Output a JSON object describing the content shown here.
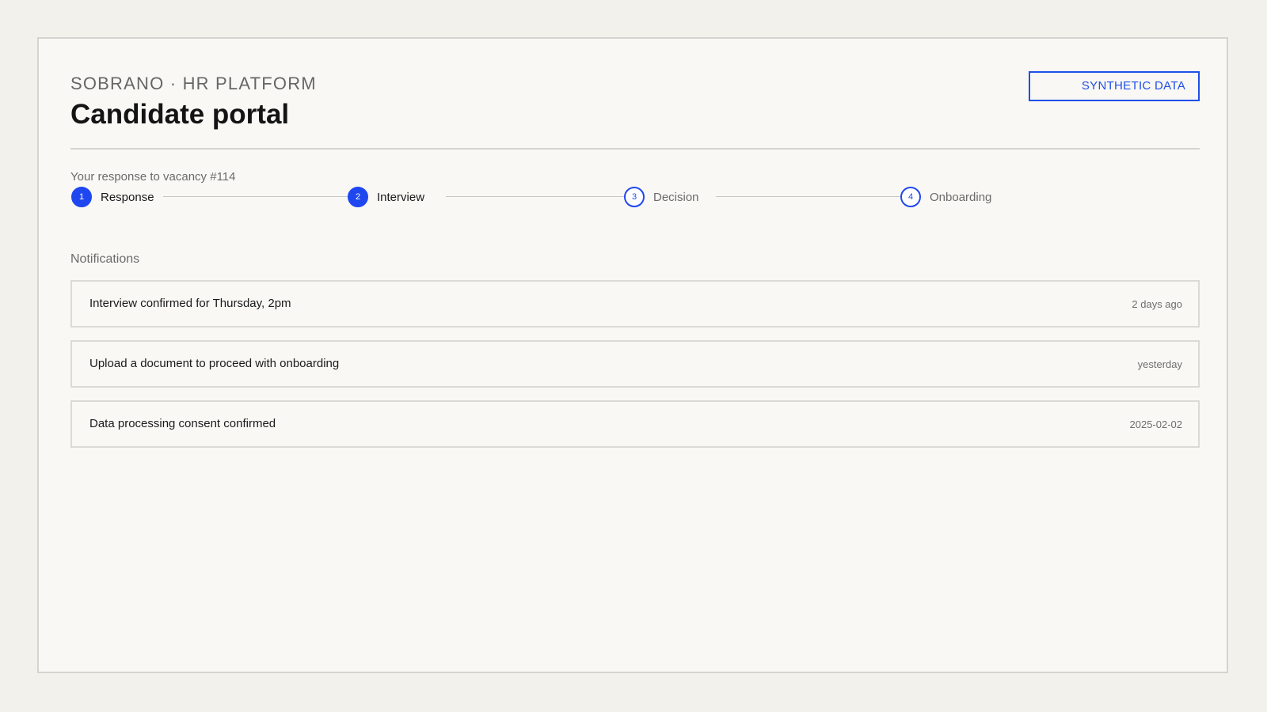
{
  "header": {
    "brand": "SOBRANO · HR PLATFORM",
    "title": "Candidate portal",
    "badge": "SYNTHETIC DATA"
  },
  "progress": {
    "caption": "Your response to vacancy #114",
    "steps": [
      {
        "number": "1",
        "label": "Response",
        "state": "done"
      },
      {
        "number": "2",
        "label": "Interview",
        "state": "current"
      },
      {
        "number": "3",
        "label": "Decision",
        "state": "pending"
      },
      {
        "number": "4",
        "label": "Onboarding",
        "state": "pending"
      }
    ]
  },
  "notifications": {
    "title": "Notifications",
    "items": [
      {
        "message": "Interview confirmed for Thursday, 2pm",
        "time": "2 days ago"
      },
      {
        "message": "Upload a document to proceed with onboarding",
        "time": "yesterday"
      },
      {
        "message": "Data processing consent confirmed",
        "time": "2025-02-02"
      }
    ]
  },
  "colors": {
    "accent": "#1f47f0",
    "background": "#f3f1ec",
    "card": "#f9f8f5"
  }
}
